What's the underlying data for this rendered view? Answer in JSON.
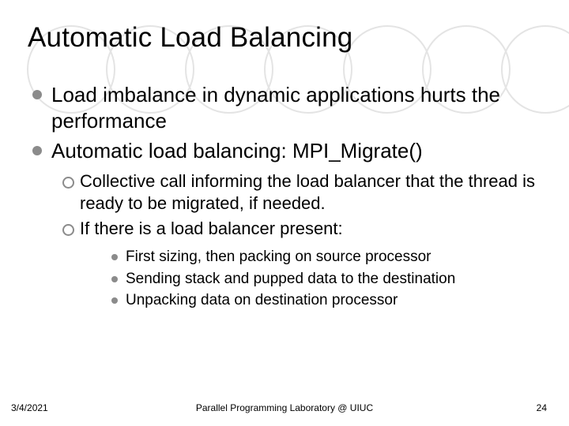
{
  "title": "Automatic Load Balancing",
  "bullets": {
    "lvl1": [
      "Load imbalance in dynamic applications hurts the performance",
      "Automatic load balancing: MPI_Migrate()"
    ],
    "lvl2": [
      "Collective call informing the load balancer that the thread is ready to be migrated, if needed.",
      "If there is a load balancer present:"
    ],
    "lvl3": [
      "First sizing, then packing on source processor",
      "Sending stack and pupped data to the destination",
      "Unpacking data on destination processor"
    ]
  },
  "footer": {
    "date": "3/4/2021",
    "center": "Parallel Programming Laboratory @ UIUC",
    "page": "24"
  }
}
